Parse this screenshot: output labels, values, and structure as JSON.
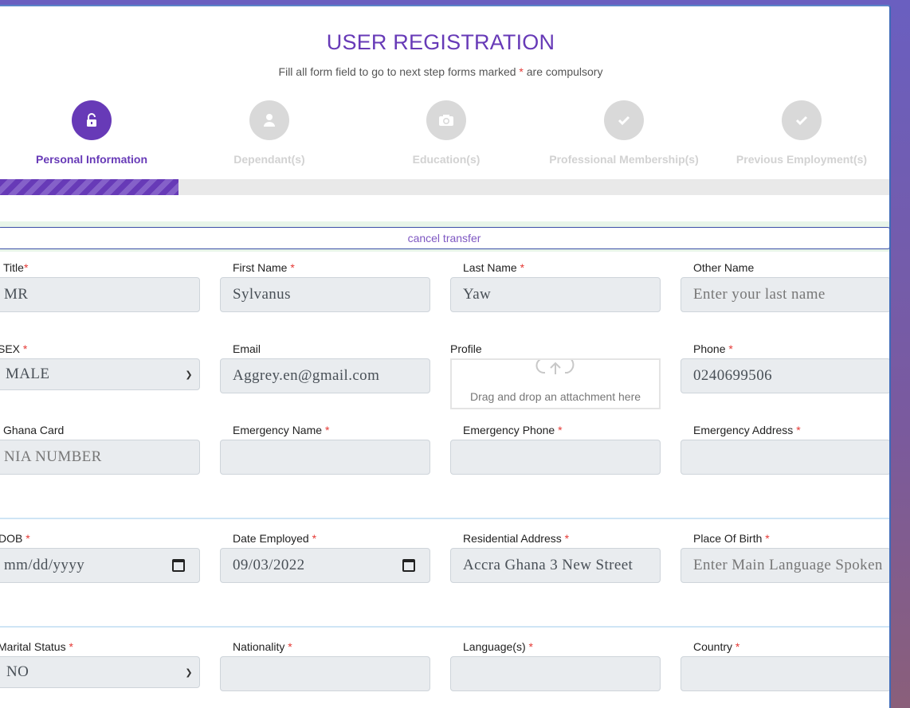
{
  "header": {
    "title": "USER REGISTRATION",
    "subtitle_pre": "Fill all form field to go to next step forms marked",
    "subtitle_star": "*",
    "subtitle_post": "are compulsory"
  },
  "steps": [
    {
      "label": "Personal Information",
      "icon": "unlock-icon",
      "active": true
    },
    {
      "label": "Dependant(s)",
      "icon": "user-icon",
      "active": false
    },
    {
      "label": "Education(s)",
      "icon": "camera-icon",
      "active": false
    },
    {
      "label": "Professional Membership(s)",
      "icon": "check-icon",
      "active": false
    },
    {
      "label": "Previous Employment(s)",
      "icon": "check-icon",
      "active": false
    }
  ],
  "progress": {
    "percent": 20
  },
  "cancel_label": "cancel transfer",
  "required_mark": "*",
  "fields": {
    "title": {
      "label": "Title",
      "value": "MR"
    },
    "first_name": {
      "label": "First Name",
      "value": "Sylvanus"
    },
    "last_name": {
      "label": "Last Name",
      "value": "Yaw"
    },
    "other_name": {
      "label": "Other Name",
      "placeholder": "Enter your last name"
    },
    "sex": {
      "label": "SEX",
      "value": "MALE"
    },
    "email": {
      "label": "Email",
      "value": "Aggrey.en@gmail.com"
    },
    "profile": {
      "label": "Profile",
      "drop_text": "Drag and drop an attachment here"
    },
    "phone": {
      "label": "Phone",
      "value": "0240699506"
    },
    "ghana_card": {
      "label": "Ghana Card",
      "placeholder": "NIA NUMBER"
    },
    "emergency_name": {
      "label": "Emergency Name",
      "value": ""
    },
    "emergency_phone": {
      "label": "Emergency Phone",
      "value": ""
    },
    "emergency_address": {
      "label": "Emergency Address",
      "value": ""
    },
    "dob": {
      "label": "DOB",
      "placeholder": "mm/dd/yyyy"
    },
    "date_employed": {
      "label": "Date Employed",
      "value": "09/03/2022"
    },
    "residential_address": {
      "label": "Residential Address",
      "value": "Accra Ghana 3 New Street"
    },
    "place_of_birth": {
      "label": "Place Of Birth",
      "placeholder": "Enter Main Language Spoken"
    },
    "marital_status": {
      "label": "Marital Status",
      "value": "NO"
    },
    "nationality": {
      "label": "Nationality",
      "value": ""
    },
    "languages": {
      "label": "Language(s)",
      "value": ""
    },
    "country": {
      "label": "Country",
      "value": ""
    }
  },
  "colors": {
    "accent": "#673ab7",
    "required": "#e53935",
    "inactive_step": "#d9d9d9"
  }
}
